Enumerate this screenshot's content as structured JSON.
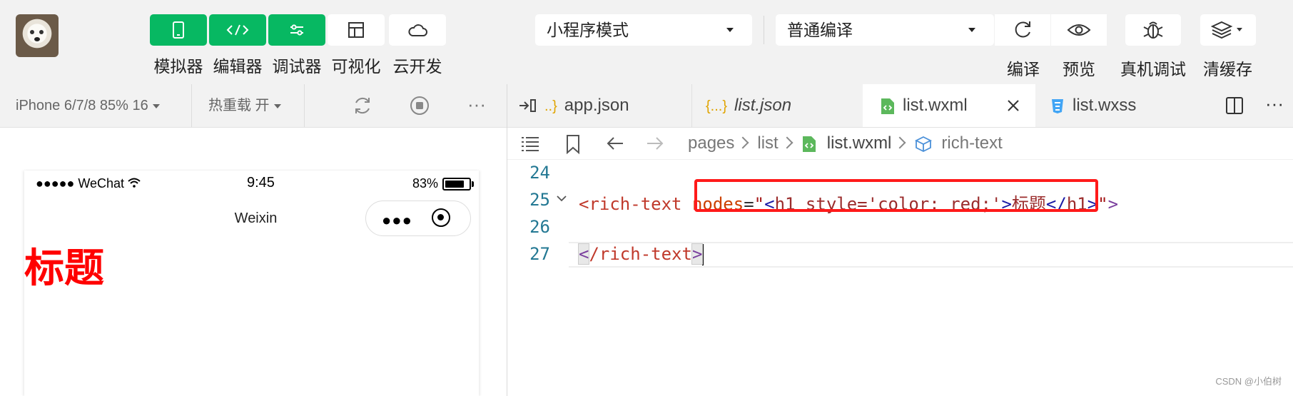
{
  "toolbar": {
    "left_buttons": [
      {
        "label": "模拟器",
        "icon": "phone-icon"
      },
      {
        "label": "编辑器",
        "icon": "code-icon"
      },
      {
        "label": "调试器",
        "icon": "sliders-icon"
      },
      {
        "label": "可视化",
        "icon": "layout-icon"
      },
      {
        "label": "云开发",
        "icon": "cloud-icon"
      }
    ],
    "mode_select": "小程序模式",
    "compile_select": "普通编译",
    "right_buttons": [
      {
        "label": "编译",
        "icon": "refresh-icon"
      },
      {
        "label": "预览",
        "icon": "eye-icon"
      },
      {
        "label": "真机调试",
        "icon": "bug-icon"
      },
      {
        "label": "清缓存",
        "icon": "layers-icon"
      }
    ]
  },
  "simulator": {
    "device": "iPhone 6/7/8 85% 16",
    "hot_reload": "热重载 开",
    "more": "···",
    "status": {
      "carrier": "●●●●● WeChat",
      "time": "9:45",
      "battery": "83%"
    },
    "nav_title": "Weixin",
    "heading": "标题"
  },
  "editor": {
    "tabs": [
      {
        "label": "app.json",
        "italic": false
      },
      {
        "label": "list.json",
        "italic": true
      },
      {
        "label": "list.wxml",
        "active": true
      },
      {
        "label": "list.wxss"
      }
    ],
    "breadcrumb": [
      "pages",
      "list",
      "list.wxml",
      "rich-text"
    ],
    "lines": [
      {
        "num": "24"
      },
      {
        "num": "25",
        "tag_open": "<rich-text",
        "attr": "nodes",
        "eq": "=",
        "q1": "\"",
        "lt": "<",
        "h1open": "h1",
        "style": " style='color: red;'",
        "gt": ">",
        "content": "标题",
        "lt2": "</",
        "h1close": "h1",
        "gt2": ">",
        "q2": "\"",
        "close": ">"
      },
      {
        "num": "26"
      },
      {
        "num": "27",
        "open": "<",
        "closing": "/rich-text",
        "end": ">"
      }
    ]
  },
  "watermark": "CSDN @小伯树",
  "colors": {
    "green": "#07b862",
    "highlight": "#ff1a1a",
    "heading": "#ff0000"
  }
}
